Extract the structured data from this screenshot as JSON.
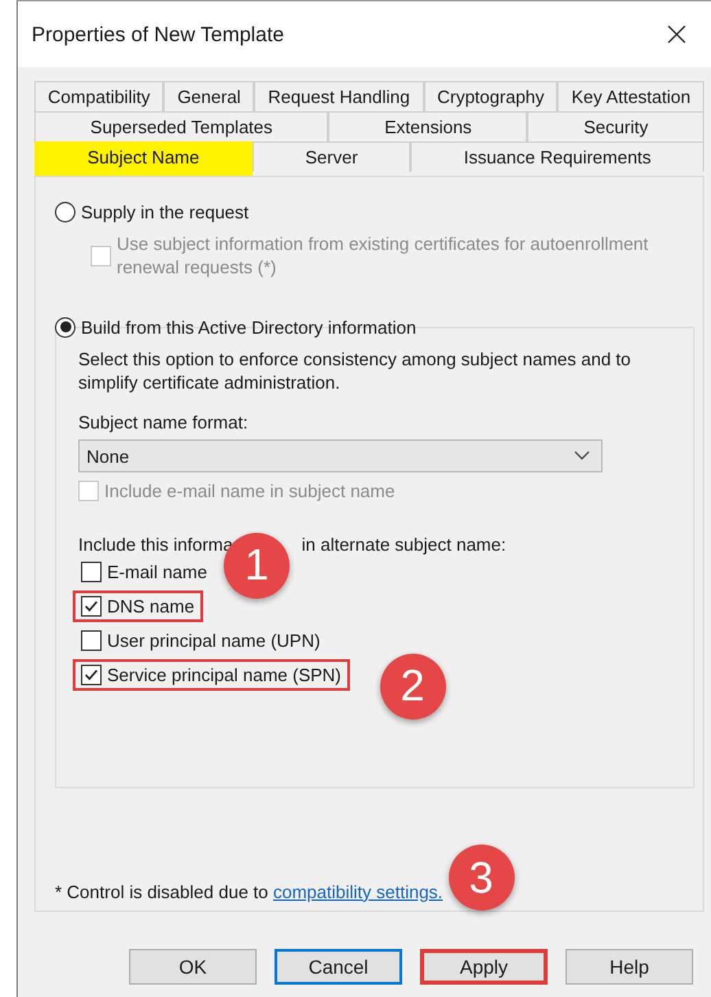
{
  "window": {
    "title": "Properties of New Template"
  },
  "tab_rows": [
    {
      "tabs": [
        {
          "label": "Compatibility",
          "selected": false
        },
        {
          "label": "General",
          "selected": false
        },
        {
          "label": "Request Handling",
          "selected": false
        },
        {
          "label": "Cryptography",
          "selected": false
        },
        {
          "label": "Key Attestation",
          "selected": false
        }
      ]
    },
    {
      "tabs": [
        {
          "label": "Superseded Templates",
          "selected": false
        },
        {
          "label": "Extensions",
          "selected": false
        },
        {
          "label": "Security",
          "selected": false
        }
      ]
    },
    {
      "tabs": [
        {
          "label": "Subject Name",
          "selected": true
        },
        {
          "label": "Server",
          "selected": false
        },
        {
          "label": "Issuance Requirements",
          "selected": false
        }
      ]
    }
  ],
  "supply": {
    "label": "Supply in the request",
    "selected": false,
    "option": {
      "label": "Use subject information from existing certificates for autoenrollment renewal requests (*)",
      "checked": false,
      "disabled": true
    }
  },
  "build": {
    "label": "Build from this Active Directory information",
    "selected": true,
    "description": "Select this option to enforce consistency among subject names and to simplify certificate administration.",
    "format_label": "Subject name format:",
    "format_value": "None",
    "include_email": {
      "label": "Include e-mail name in subject name",
      "checked": false,
      "disabled": true
    },
    "alt_label_parts": [
      "Include this informa",
      "in alternate subject name:"
    ],
    "alt_items": [
      {
        "label": "E-mail name",
        "checked": false,
        "highlighted": false,
        "callout": "1"
      },
      {
        "label": "DNS name",
        "checked": true,
        "highlighted": true
      },
      {
        "label": "User principal name (UPN)",
        "checked": false,
        "highlighted": false
      },
      {
        "label": "Service principal name (SPN)",
        "checked": true,
        "highlighted": true,
        "callout": "2"
      }
    ]
  },
  "footnote": {
    "text": "* Control is disabled due to ",
    "link": "compatibility settings.",
    "callout": "3"
  },
  "buttons": [
    {
      "label": "OK",
      "focused": false,
      "highlighted": false
    },
    {
      "label": "Cancel",
      "focused": true,
      "highlighted": false
    },
    {
      "label": "Apply",
      "focused": false,
      "highlighted": true
    },
    {
      "label": "Help",
      "focused": false,
      "highlighted": false
    }
  ]
}
